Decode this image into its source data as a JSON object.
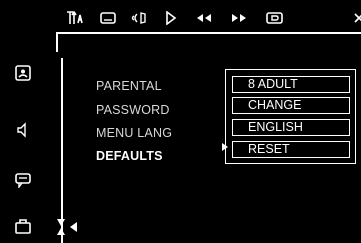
{
  "topbar": {
    "icons": [
      "title-chapter-icon",
      "subtitle-icon",
      "audio-icon",
      "play-icon",
      "rewind-icon",
      "fast-forward-icon",
      "display-icon",
      "close-icon"
    ]
  },
  "sidebar": {
    "icons": [
      "picture-setup-icon",
      "audio-setup-icon",
      "language-setup-icon",
      "features-setup-icon"
    ]
  },
  "menu": {
    "items": [
      {
        "label": "PARENTAL",
        "value": "8 ADULT"
      },
      {
        "label": "PASSWORD",
        "value": "CHANGE"
      },
      {
        "label": "MENU LANG",
        "value": "ENGLISH"
      },
      {
        "label": "DEFAULTS",
        "value": "RESET"
      }
    ],
    "selected_index": 3
  },
  "colors": {
    "background": "#000000",
    "foreground": "#ffffff",
    "inactive_text": "#d8d8d8"
  }
}
